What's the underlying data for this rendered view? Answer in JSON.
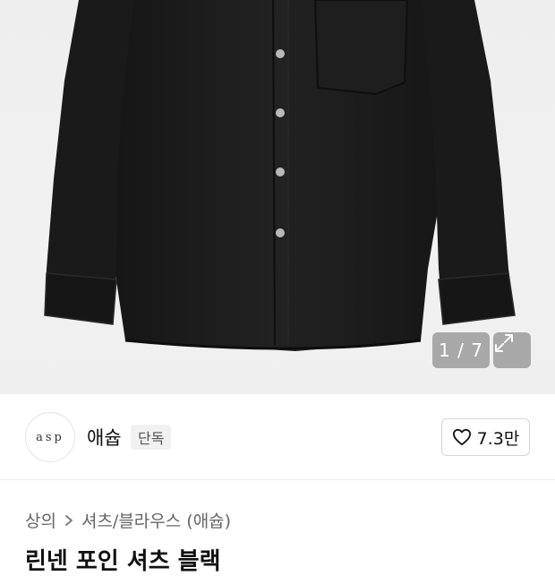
{
  "gallery": {
    "counter": "1 / 7",
    "expand_icon": "expand-arrows-icon"
  },
  "brand": {
    "logo_text": "asp",
    "name": "애슙",
    "badge": "단독",
    "like_icon": "heart-outline-icon",
    "like_count": "7.3만"
  },
  "breadcrumb": {
    "items": [
      "상의",
      "셔츠/블라우스 (애슙)"
    ],
    "separator_icon": "chevron-right-icon"
  },
  "product": {
    "title": "린넨 포인 셔츠 블랙"
  },
  "colors": {
    "shirt": "#1b1b1b",
    "background": "#efefef",
    "overlay": "#6e6e6e"
  }
}
